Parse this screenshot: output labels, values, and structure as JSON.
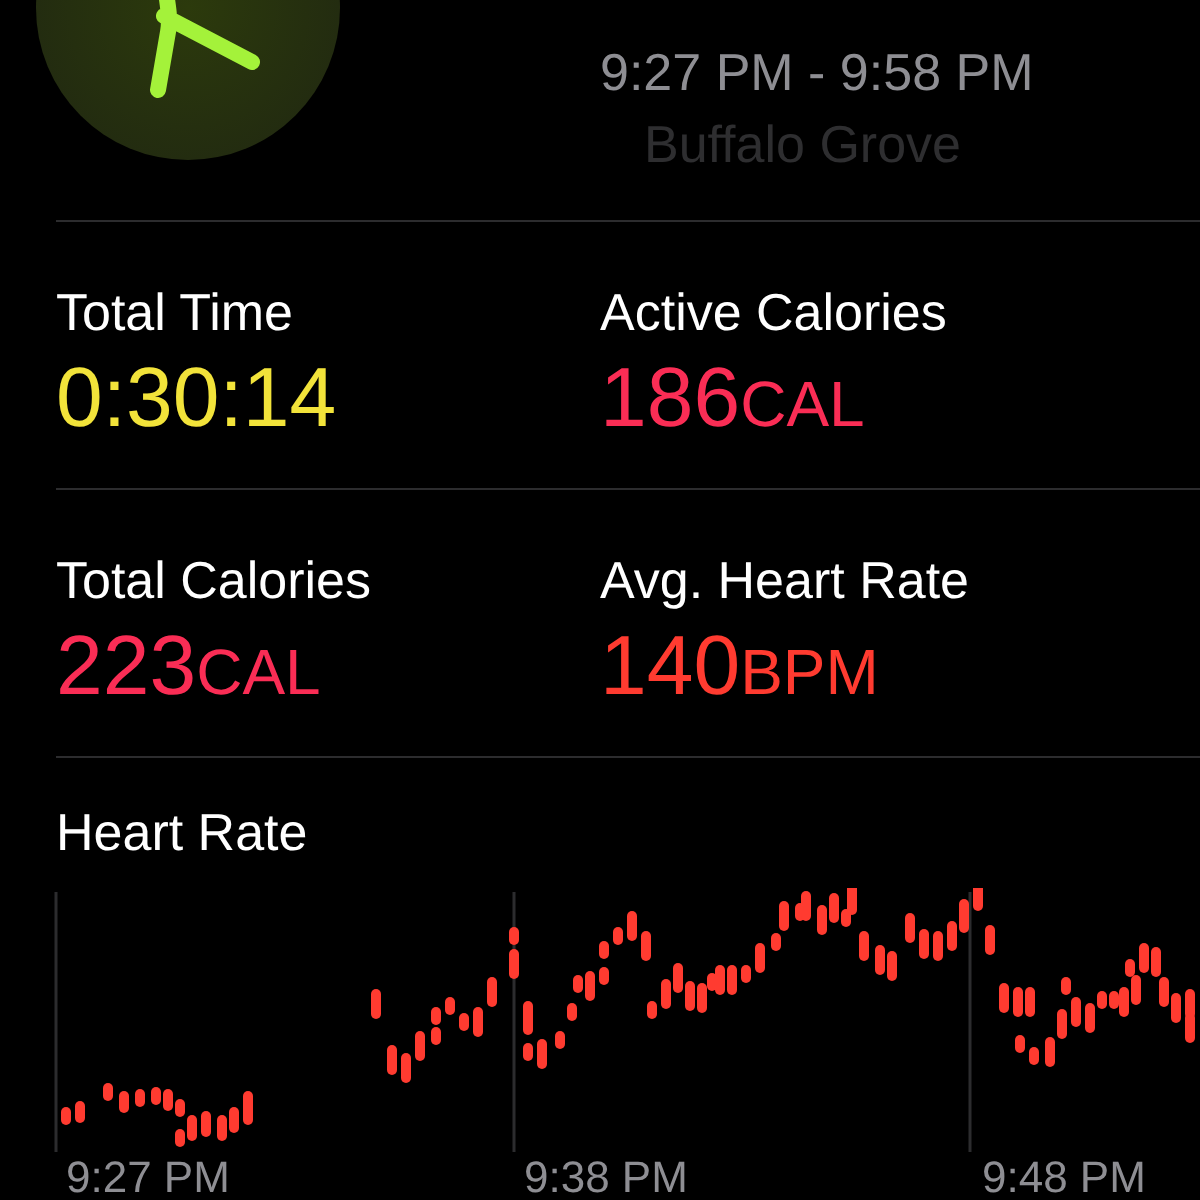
{
  "header": {
    "time_range": "9:27 PM - 9:58 PM",
    "location": "Buffalo Grove"
  },
  "stats": [
    {
      "label": "Total Time",
      "value": "0:30:14",
      "color": "#f2e33a"
    },
    {
      "label": "Active Calories",
      "value": "186",
      "unit": "CAL",
      "color": "#fa2d55"
    },
    {
      "label": "Total Calories",
      "value": "223",
      "unit": "CAL",
      "color": "#fa2d55"
    },
    {
      "label": "Avg. Heart Rate",
      "value": "140",
      "unit": "BPM",
      "color": "#ff3b30"
    }
  ],
  "heart_rate": {
    "title": "Heart Rate",
    "time_labels": [
      "9:27 PM",
      "9:38 PM",
      "9:48 PM"
    ]
  }
}
